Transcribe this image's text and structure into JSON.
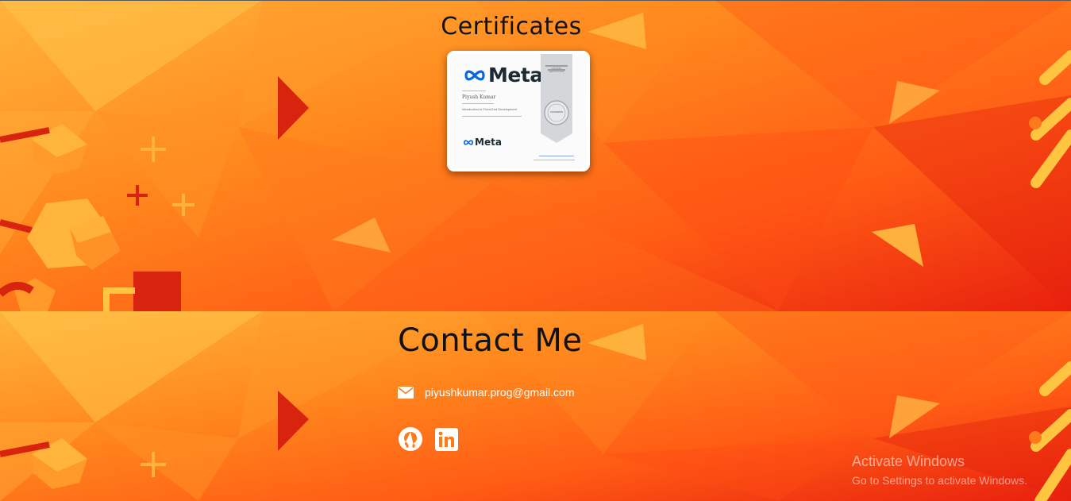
{
  "certificates": {
    "title": "Certificates",
    "card": {
      "logo_text": "Meta",
      "recipient": "Piyush Kumar",
      "course": "Introduction to Front-End Development",
      "ribbon_label": "COURSE CERTIFICATE",
      "seal_label": "coursera",
      "footer_logo_text": "Meta"
    }
  },
  "contact": {
    "title": "Contact Me",
    "email": "piyushkumar.prog@gmail.com",
    "social": [
      {
        "name": "GitHub",
        "icon": "github-icon"
      },
      {
        "name": "LinkedIn",
        "icon": "linkedin-icon"
      }
    ]
  },
  "watermark": {
    "line1": "Activate Windows",
    "line2": "Go to Settings to activate Windows."
  },
  "colors": {
    "bg_orange_light": "#ffb347",
    "bg_orange": "#ff7a1a",
    "bg_red": "#f0361a",
    "meta_blue": "#0668e1",
    "text_dark": "#111111",
    "text_white": "#ffffff"
  }
}
